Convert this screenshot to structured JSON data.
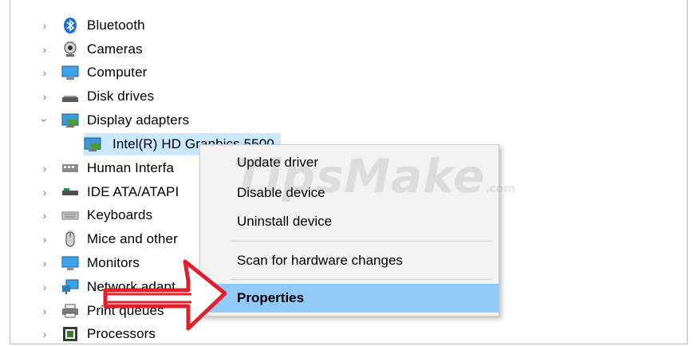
{
  "tree": {
    "items": [
      {
        "label": "Bluetooth",
        "icon": "bluetooth-icon",
        "expanded": false
      },
      {
        "label": "Cameras",
        "icon": "camera-icon",
        "expanded": false
      },
      {
        "label": "Computer",
        "icon": "computer-icon",
        "expanded": false
      },
      {
        "label": "Disk drives",
        "icon": "disk-drive-icon",
        "expanded": false
      },
      {
        "label": "Display adapters",
        "icon": "display-adapter-icon",
        "expanded": true
      },
      {
        "label": "Intel(R) HD Graphics 5500",
        "icon": "display-adapter-icon",
        "child": true,
        "selected": true
      },
      {
        "label": "Human Interfa",
        "icon": "hid-icon",
        "expanded": false
      },
      {
        "label": "IDE ATA/ATAPI",
        "icon": "ide-controller-icon",
        "expanded": false
      },
      {
        "label": "Keyboards",
        "icon": "keyboard-icon",
        "expanded": false
      },
      {
        "label": "Mice and other",
        "icon": "mouse-icon",
        "expanded": false
      },
      {
        "label": "Monitors",
        "icon": "monitor-icon",
        "expanded": false
      },
      {
        "label": "Network adapt",
        "icon": "network-adapter-icon",
        "expanded": false
      },
      {
        "label": "Print queues",
        "icon": "printer-icon",
        "expanded": false
      },
      {
        "label": "Processors",
        "icon": "processor-icon",
        "expanded": false
      }
    ]
  },
  "context_menu": {
    "items": [
      "Update driver",
      "Disable device",
      "Uninstall device",
      "Scan for hardware changes",
      "Properties"
    ],
    "highlighted": "Properties"
  },
  "watermark": {
    "text": "TipsMake",
    "suffix": ".com"
  },
  "colors": {
    "selection": "#cce8ff",
    "menu_highlight": "#91c9f7",
    "arrow": "#e0202a"
  }
}
